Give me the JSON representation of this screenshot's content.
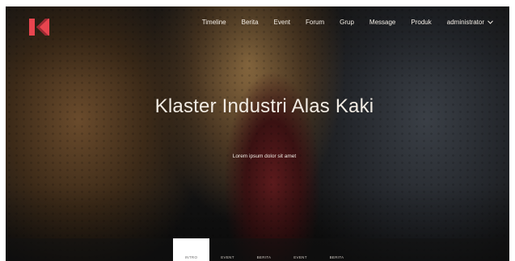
{
  "colors": {
    "brand": "#e8454f",
    "nav_text": "#f4eee6",
    "active_tab_bg": "#ffffff"
  },
  "logo": {
    "icon": "logo-k-icon"
  },
  "nav": {
    "items": [
      {
        "label": "Timeline"
      },
      {
        "label": "Berita"
      },
      {
        "label": "Event"
      },
      {
        "label": "Forum"
      },
      {
        "label": "Grup"
      },
      {
        "label": "Message"
      },
      {
        "label": "Produk"
      }
    ],
    "user": {
      "label": "administrator",
      "icon": "chevron-down-icon"
    }
  },
  "hero": {
    "title": "Klaster Industri Alas Kaki",
    "subtitle": "Lorem ipsum dolor sit amet"
  },
  "tabs": [
    {
      "label": "INTRO",
      "active": true
    },
    {
      "label": "EVENT"
    },
    {
      "label": "BERITA"
    },
    {
      "label": "EVENT"
    },
    {
      "label": "BERITA"
    }
  ]
}
